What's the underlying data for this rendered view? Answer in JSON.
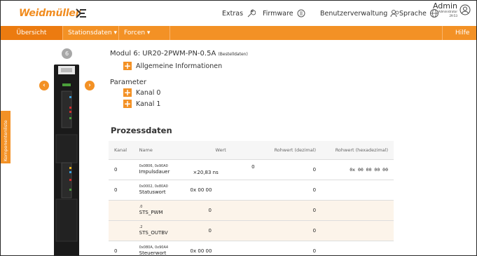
{
  "header": {
    "brand": "Weidmüller",
    "nav": [
      {
        "label": "Extras",
        "icon": "wrench-icon"
      },
      {
        "label": "Firmware",
        "icon": "refresh-icon"
      },
      {
        "label": "Benutzerverwaltung",
        "icon": "users-icon"
      },
      {
        "label": "Sprache",
        "icon": "globe-icon"
      }
    ],
    "user": {
      "name": "Admin",
      "role": "Administrator",
      "time": "29:53"
    }
  },
  "menu": {
    "items": [
      "Übersicht",
      "Stationsdaten ▾",
      "Forcen ▾"
    ],
    "help": "Hilfe"
  },
  "sidebar_tab": "Komponentenliste",
  "module": {
    "slot": "6",
    "title": "Modul 6: UR20-2PWM-PN-0.5A",
    "title_suffix": "(Bestelldaten)",
    "general_info": "Allgemeine Informationen",
    "parameter_label": "Parameter",
    "channels": [
      "Kanal 0",
      "Kanal 1"
    ]
  },
  "process_data": {
    "title": "Prozessdaten",
    "columns": [
      "Kanal",
      "Name",
      "Wert",
      "Rohwert (dezimal)",
      "Rohwert (hexadezimal)"
    ],
    "rows": [
      {
        "kanal": "0",
        "addr": "0x0806, 0x90A0",
        "name": "Impulsdauer",
        "wert": "0",
        "extra": "×20,83 ns",
        "dez": "0",
        "hex": "0x 00 00 00 00",
        "sub": false
      },
      {
        "kanal": "0",
        "addr": "0x0002, 0x80A0",
        "name": "Statuswort",
        "wert": "0x 00 00",
        "extra": "",
        "dez": "0",
        "hex": "",
        "sub": false
      },
      {
        "kanal": "",
        "addr": ".0",
        "name": "STS_PWM",
        "wert": "0",
        "extra": "",
        "dez": "0",
        "hex": "",
        "sub": true
      },
      {
        "kanal": "",
        "addr": ".2",
        "name": "STS_OUTBV",
        "wert": "0",
        "extra": "",
        "dez": "0",
        "hex": "",
        "sub": true
      },
      {
        "kanal": "0",
        "addr": "0x080A, 0x90A4",
        "name": "Steuerwort",
        "wert": "0x 00 00",
        "extra": "",
        "dez": "0",
        "hex": "",
        "sub": false
      }
    ]
  },
  "colors": {
    "accent": "#f39125",
    "accent_dark": "#ec7b10",
    "module": "#1a1a1a"
  }
}
